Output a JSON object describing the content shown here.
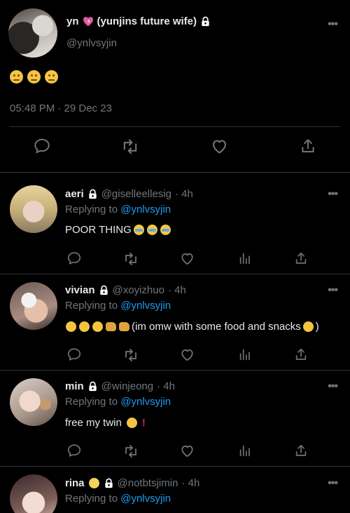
{
  "main_tweet": {
    "display_name": "yn",
    "name_suffix": "(yunjins future wife)",
    "handle": "@ynlvsyjin",
    "content_emojis": [
      "confused-face",
      "confused-face",
      "confused-face"
    ],
    "timestamp": "05:48 PM · 29 Dec 23",
    "more_label": "•••"
  },
  "replies": [
    {
      "name": "aeri",
      "handle": "@giselleellesig",
      "time": "· 4h",
      "replying_prefix": "Replying to",
      "replying_handle": "@ynlvsyjin",
      "text": "POOR THING",
      "text_suffix": ")"
    },
    {
      "name": "vivian",
      "handle": "@xoyizhuo",
      "time": "· 4h",
      "replying_prefix": "Replying to",
      "replying_handle": "@ynlvsyjin",
      "text": "(im omw with some food and snacks",
      "text_suffix": ")"
    },
    {
      "name": "min",
      "handle": "@winjeong",
      "time": "· 4h",
      "replying_prefix": "Replying to",
      "replying_handle": "@ynlvsyjin",
      "text": "free my twin",
      "text_suffix": "!"
    },
    {
      "name": "rina",
      "handle": "@notbtsjimin",
      "time": "· 4h",
      "replying_prefix": "Replying to",
      "replying_handle": "@ynlvsyjin"
    }
  ],
  "more_label": "•••",
  "colors": {
    "background": "#000000",
    "text": "#e7e9ea",
    "muted": "#71767b",
    "link": "#1d9bf0",
    "divider": "#2f3336"
  }
}
